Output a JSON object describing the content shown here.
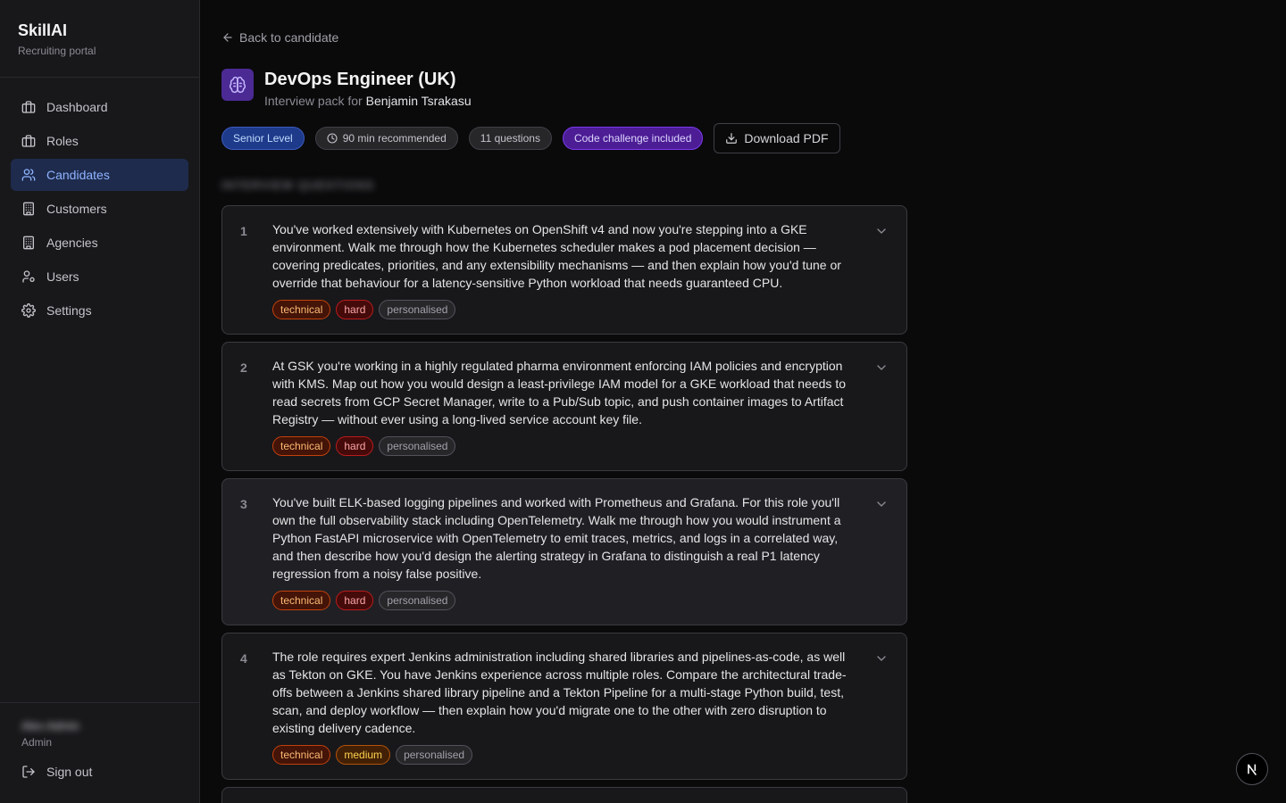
{
  "brand": {
    "name": "SkillAI",
    "subtitle": "Recruiting portal"
  },
  "nav": [
    {
      "label": "Dashboard",
      "icon": "briefcase-icon",
      "active": false
    },
    {
      "label": "Roles",
      "icon": "briefcase-icon",
      "active": false
    },
    {
      "label": "Candidates",
      "icon": "users-icon",
      "active": true
    },
    {
      "label": "Customers",
      "icon": "building-icon",
      "active": false
    },
    {
      "label": "Agencies",
      "icon": "building-icon",
      "active": false
    },
    {
      "label": "Users",
      "icon": "user-cog-icon",
      "active": false
    },
    {
      "label": "Settings",
      "icon": "gear-icon",
      "active": false
    }
  ],
  "user": {
    "name": "Alex Admin",
    "role": "Admin",
    "signout_label": "Sign out"
  },
  "back_label": "Back to candidate",
  "header": {
    "title": "DevOps Engineer (UK)",
    "subtitle_prefix": "Interview pack for ",
    "candidate_name": "Benjamin Tsrakasu"
  },
  "badges": {
    "level": "Senior Level",
    "duration": "90 min recommended",
    "count": "11 questions",
    "code": "Code challenge included"
  },
  "download_label": "Download PDF",
  "section_title": "INTERVIEW QUESTIONS",
  "colors": {
    "accent": "#8fb3ff",
    "active_bg": "#1e2b4d",
    "brand_icon_bg": "#4b2a94"
  },
  "questions": [
    {
      "number": "1",
      "text": "You've worked extensively with Kubernetes on OpenShift v4 and now you're stepping into a GKE environment. Walk me through how the Kubernetes scheduler makes a pod placement decision — covering predicates, priorities, and any extensibility mechanisms — and then explain how you'd tune or override that behaviour for a latency-sensitive Python workload that needs guaranteed CPU.",
      "tags": [
        "technical",
        "hard",
        "personalised"
      ]
    },
    {
      "number": "2",
      "text": "At GSK you're working in a highly regulated pharma environment enforcing IAM policies and encryption with KMS. Map out how you would design a least-privilege IAM model for a GKE workload that needs to read secrets from GCP Secret Manager, write to a Pub/Sub topic, and push container images to Artifact Registry — without ever using a long-lived service account key file.",
      "tags": [
        "technical",
        "hard",
        "personalised"
      ]
    },
    {
      "number": "3",
      "text": "You've built ELK-based logging pipelines and worked with Prometheus and Grafana. For this role you'll own the full observability stack including OpenTelemetry. Walk me through how you would instrument a Python FastAPI microservice with OpenTelemetry to emit traces, metrics, and logs in a correlated way, and then describe how you'd design the alerting strategy in Grafana to distinguish a real P1 latency regression from a noisy false positive.",
      "tags": [
        "technical",
        "hard",
        "personalised"
      ]
    },
    {
      "number": "4",
      "text": "The role requires expert Jenkins administration including shared libraries and pipelines-as-code, as well as Tekton on GKE. You have Jenkins experience across multiple roles. Compare the architectural trade-offs between a Jenkins shared library pipeline and a Tekton Pipeline for a multi-stage Python build, test, scan, and deploy workflow — then explain how you'd migrate one to the other with zero disruption to existing delivery cadence.",
      "tags": [
        "technical",
        "medium",
        "personalised"
      ]
    }
  ]
}
